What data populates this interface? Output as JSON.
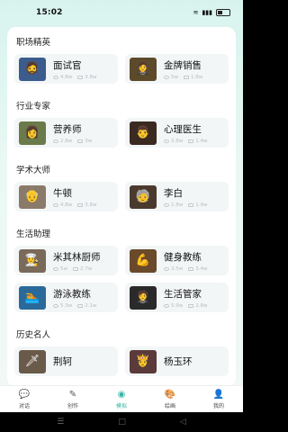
{
  "status_bar": {
    "time": "15:02",
    "signal_text": "",
    "battery_label": ""
  },
  "sections": [
    {
      "title": "职场精英",
      "items": [
        {
          "name": "面试官",
          "views": "4.8w",
          "chats": "3.8w",
          "icon": "interviewer-avatar",
          "color": "#3b5c8c"
        },
        {
          "name": "金牌销售",
          "views": "5w",
          "chats": "1.8w",
          "icon": "sales-avatar",
          "color": "#5c4a2b"
        }
      ]
    },
    {
      "title": "行业专家",
      "items": [
        {
          "name": "营养师",
          "views": "2.8w",
          "chats": "3w",
          "icon": "nutritionist-avatar",
          "color": "#6a7a4a"
        },
        {
          "name": "心理医生",
          "views": "3.8w",
          "chats": "1.4w",
          "icon": "psychologist-avatar",
          "color": "#3a2a22"
        }
      ]
    },
    {
      "title": "学术大师",
      "items": [
        {
          "name": "牛顿",
          "views": "4.8w",
          "chats": "3.8w",
          "icon": "newton-avatar",
          "color": "#8a7a6a"
        },
        {
          "name": "李白",
          "views": "1.8w",
          "chats": "1.9w",
          "icon": "libai-avatar",
          "color": "#4a3a2e"
        }
      ]
    },
    {
      "title": "生活助理",
      "items": [
        {
          "name": "米其林厨师",
          "views": "5w",
          "chats": "2.7w",
          "icon": "chef-avatar",
          "color": "#7a6a5a"
        },
        {
          "name": "健身教练",
          "views": "3.5w",
          "chats": "3.4w",
          "icon": "fitness-coach-avatar",
          "color": "#6a4a2a"
        },
        {
          "name": "游泳教练",
          "views": "5.3w",
          "chats": "2.1w",
          "icon": "swim-coach-avatar",
          "color": "#2a6a9a"
        },
        {
          "name": "生活管家",
          "views": "5.9w",
          "chats": "2.8w",
          "icon": "butler-avatar",
          "color": "#2a2a2a"
        }
      ]
    },
    {
      "title": "历史名人",
      "items": [
        {
          "name": "荆轲",
          "views": "",
          "chats": "",
          "icon": "jingke-avatar",
          "color": "#6a5a4a"
        },
        {
          "name": "杨玉环",
          "views": "",
          "chats": "",
          "icon": "yangyuhuan-avatar",
          "color": "#5a3a3a"
        }
      ]
    }
  ],
  "tabbar": {
    "tabs": [
      {
        "label": "对话",
        "icon": "chat-bubble-icon"
      },
      {
        "label": "创作",
        "icon": "feather-icon"
      },
      {
        "label": "模拟",
        "icon": "simulate-icon",
        "active": true
      },
      {
        "label": "绘画",
        "icon": "palette-icon"
      },
      {
        "label": "我的",
        "icon": "user-icon"
      }
    ]
  },
  "colors": {
    "accent": "#36b6a6",
    "card_bg": "#f3f6f7"
  }
}
